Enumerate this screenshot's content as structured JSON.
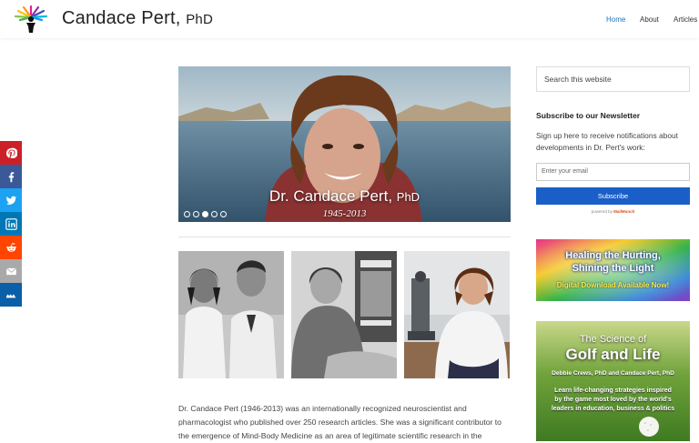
{
  "header": {
    "site_title": "Candace Pert,",
    "site_title_suffix": "PhD",
    "nav": [
      "Home",
      "About",
      "Articles"
    ]
  },
  "share": {
    "icons": [
      "pinterest-icon",
      "facebook-icon",
      "twitter-icon",
      "linkedin-icon",
      "reddit-icon",
      "email-icon",
      "sumome-icon"
    ],
    "colors": [
      "#cb2027",
      "#3b5998",
      "#1da1f2",
      "#0077b5",
      "#ff4500",
      "#a9a9a9",
      "#0b5ea8"
    ]
  },
  "hero": {
    "name": "Dr. Candace Pert,",
    "name_suffix": "PhD",
    "years": "1945-2013",
    "slide_count": 5,
    "active_slide": 3
  },
  "main": {
    "intro_lines": [
      "Dr. Candace Pert (1946-2013) was an internationally recognized neuroscientist and",
      "pharmacologist who published over 250 research articles. She was a significant contributor to",
      "the emergence of Mind-Body Medicine as an area of legitimate scientific research in the"
    ]
  },
  "sidebar": {
    "search_placeholder": "Search this website",
    "newsletter_title": "Subscribe to our Newsletter",
    "newsletter_text": "Sign up here to receive notifications about developments in Dr. Pert's work:",
    "email_placeholder": "Enter your email",
    "subscribe_label": "Subscribe",
    "powered_by": "powered by",
    "powered_brand": "MailMunch",
    "ad1": {
      "line1": "Healing the Hurting,",
      "line2": "Shining the Light",
      "line3": "Digital Download Available Now!"
    },
    "ad2": {
      "line1": "The Science of",
      "line2": "Golf and Life",
      "line3": "Debbie Crews, PhD and Candace Pert, PhD",
      "line4": "Learn life-changing strategies inspired",
      "line5": "by the game most loved by the world's",
      "line6": "leaders in education, business & politics"
    }
  },
  "colors": {
    "accent": "#1e73be",
    "subscribe": "#1a5fc7"
  }
}
